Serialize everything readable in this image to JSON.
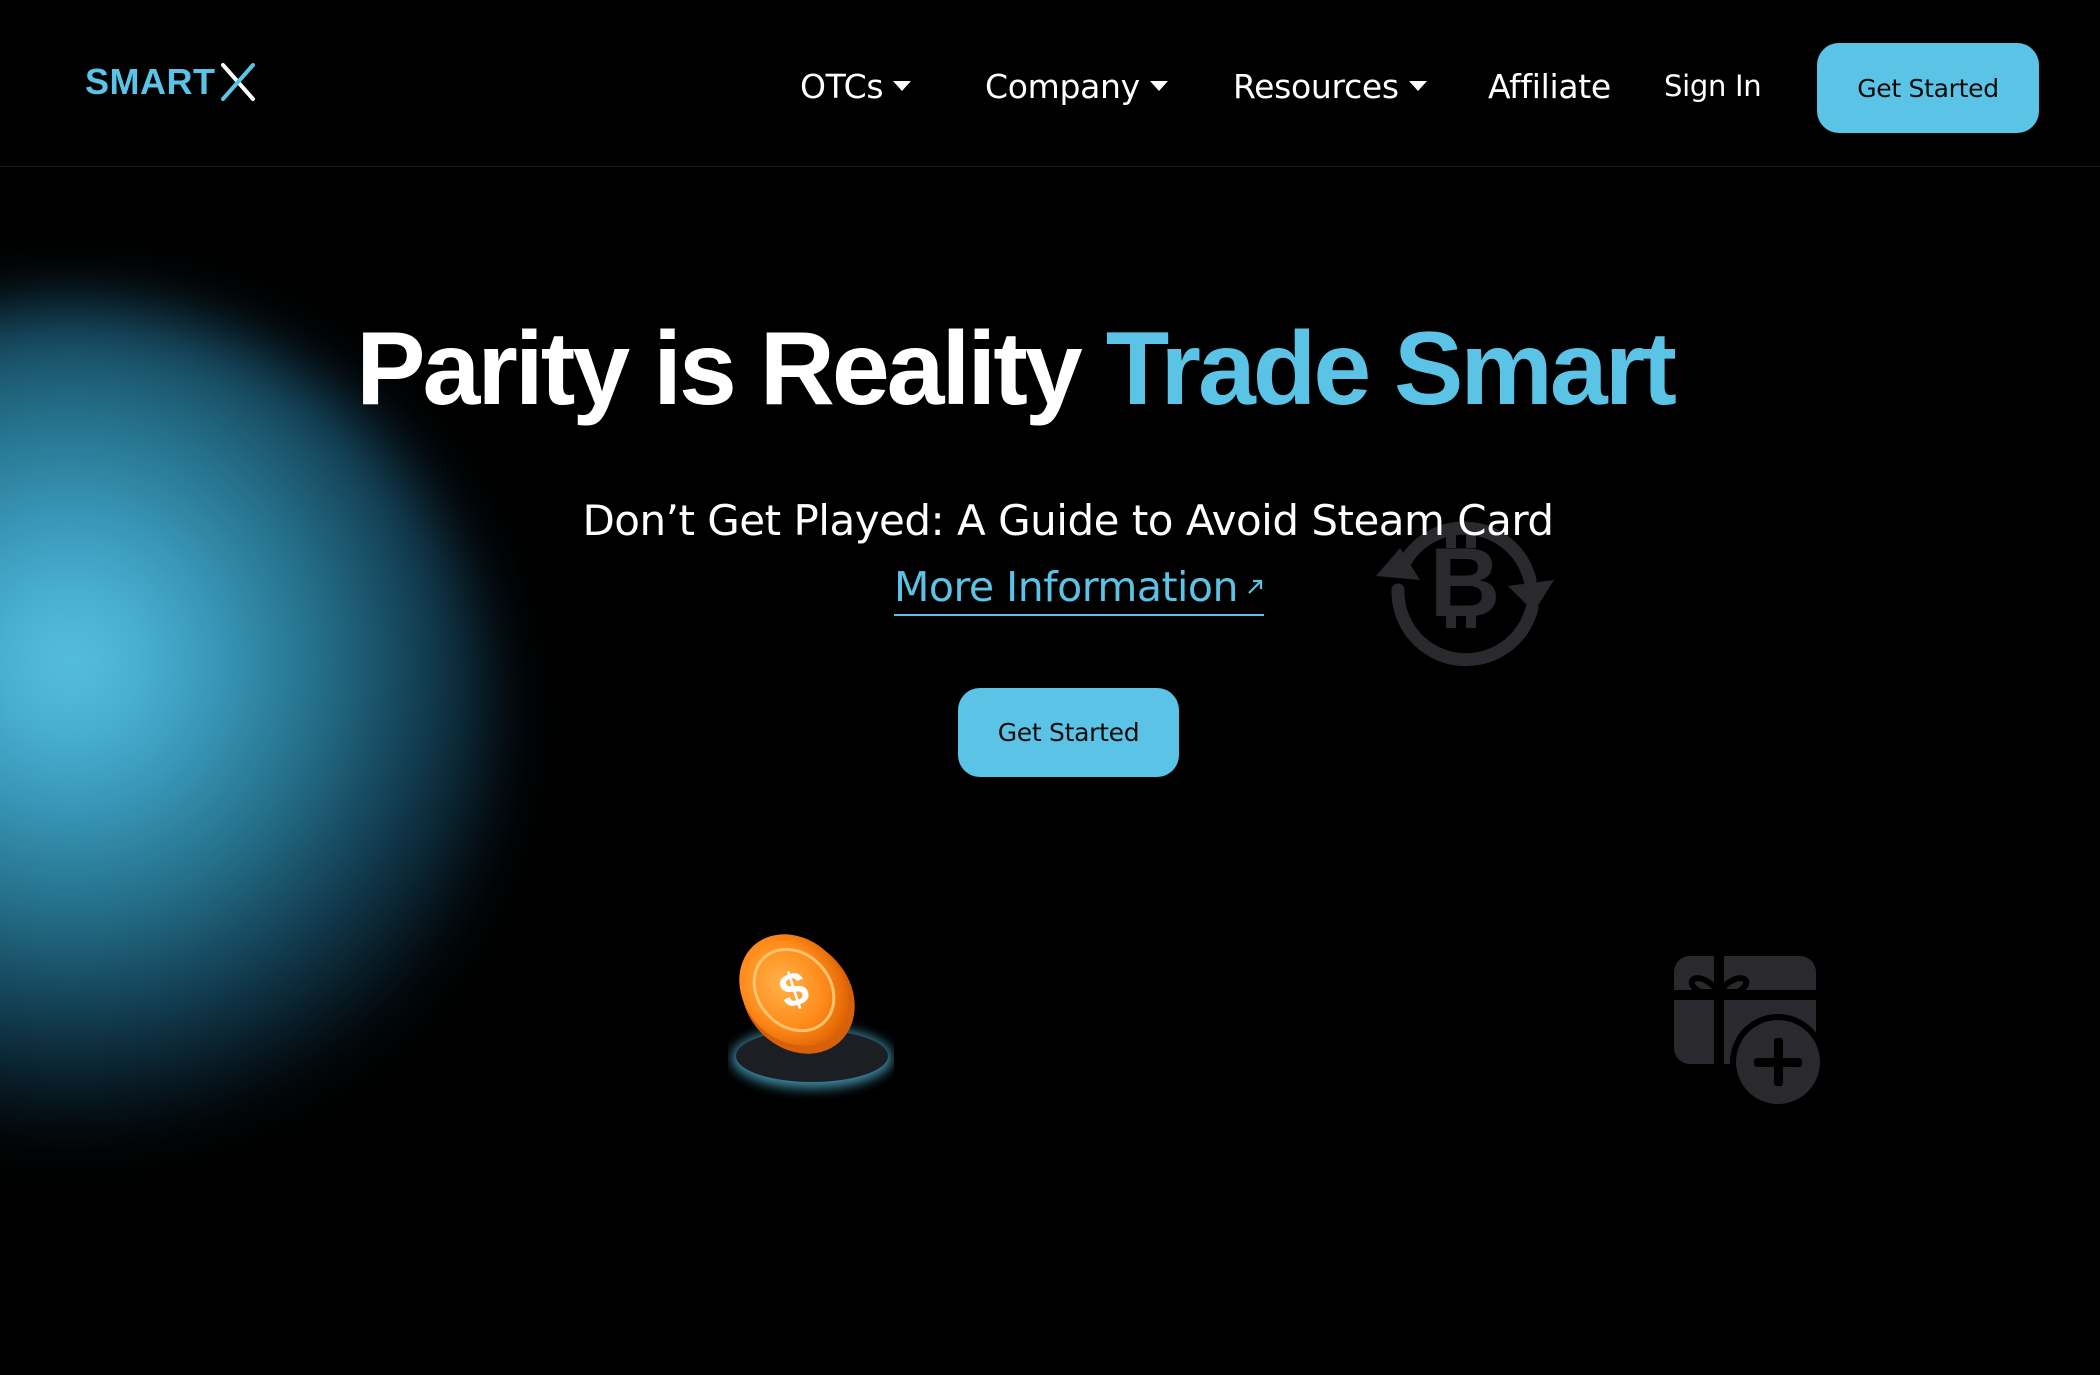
{
  "brand": {
    "name": "SMART",
    "accent_color": "#5ac3e6"
  },
  "nav": {
    "items": [
      {
        "label": "OTCs",
        "has_dropdown": true
      },
      {
        "label": "Company",
        "has_dropdown": true
      },
      {
        "label": "Resources",
        "has_dropdown": true
      },
      {
        "label": "Affiliate",
        "has_dropdown": false
      }
    ],
    "sign_in": "Sign In",
    "cta": "Get Started"
  },
  "hero": {
    "title_main": "Parity is Reality",
    "title_accent": "Trade Smart",
    "subtitle": "Don’t Get Played: A Guide to Avoid Steam Card",
    "link_label": "More Information",
    "cta": "Get Started"
  },
  "icons": [
    "bitcoin-exchange-icon",
    "dollar-coin-icon",
    "gift-card-add-icon",
    "chevron-down-icon",
    "external-arrow-icon"
  ],
  "colors": {
    "background": "#000000",
    "accent": "#5ac3e6",
    "button_text": "#0b0b0b"
  }
}
